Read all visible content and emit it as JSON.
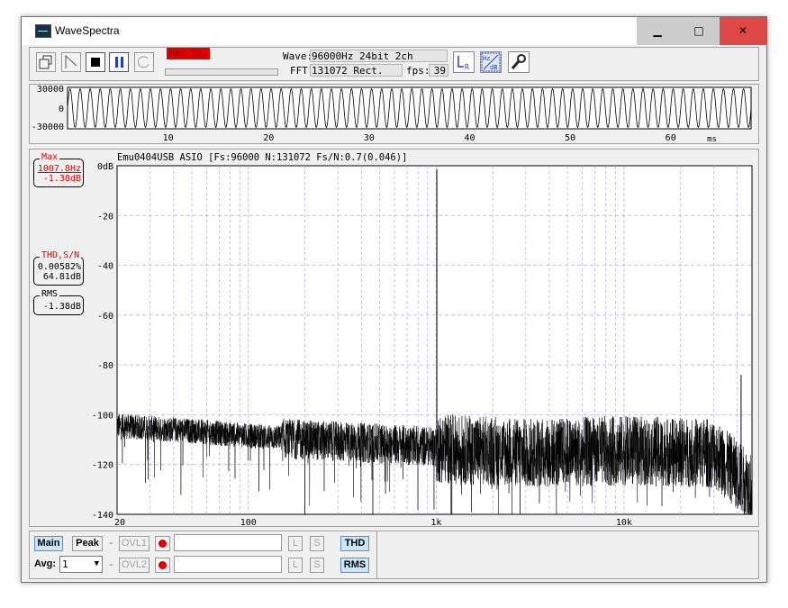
{
  "window": {
    "title": "WaveSpectra",
    "minimize_glyph": "▁",
    "maximize_glyph": "□",
    "close_glyph": "✕"
  },
  "toolbar": {
    "rec_badge": "Rec.In.",
    "wave_label": "Wave:",
    "wave_value": "96000Hz 24bit 2ch",
    "fft_label": "FFT:",
    "fft_value": "131072 Rect.",
    "fps_label": "fps:",
    "fps_value": "39",
    "lr_icon_text": "L R",
    "hzdb_icon_text": "Hz dB",
    "icons": [
      "open-icon",
      "ramp-icon",
      "stop-icon",
      "pause-icon",
      "refresh-icon",
      "lr-icon",
      "hz-db-icon",
      "settings-icon"
    ]
  },
  "waveform": {
    "y_ticks": [
      "30000",
      "0",
      "-30000"
    ],
    "x_ticks": [
      "10",
      "20",
      "30",
      "40",
      "50",
      "60"
    ],
    "x_unit": "ms",
    "x_range_ms": [
      0,
      68
    ],
    "frequency_hz": 1000,
    "amplitude": 28000
  },
  "spectrum": {
    "header": "Emu0404USB ASIO  [Fs:96000 N:131072 Fs/N:0.7(0.046)]",
    "max": {
      "label": "Max",
      "freq": "1007.8Hz",
      "level": "-1.38dB"
    },
    "thd": {
      "label": "THD,S/N",
      "thd": "0.00582%",
      "sn": "64.81dB"
    },
    "rms": {
      "label": "RMS",
      "value": "-1.38dB"
    }
  },
  "chart_data": {
    "type": "line",
    "xscale": "log",
    "xlim": [
      20,
      48000
    ],
    "ylim": [
      -140,
      0
    ],
    "x_tick_labels": [
      "20",
      "100",
      "1k",
      "10k"
    ],
    "y_tick_labels": [
      "0dB",
      "-20",
      "-40",
      "-60",
      "-80",
      "-100",
      "-120",
      "-140"
    ],
    "grid": true,
    "peaks": [
      {
        "x": 1007.8,
        "y": -1.38
      },
      {
        "x": 3000,
        "y": -128
      },
      {
        "x": 3300,
        "y": -116
      },
      {
        "x": 15000,
        "y": -116
      },
      {
        "x": 17000,
        "y": -123
      },
      {
        "x": 20000,
        "y": -108
      },
      {
        "x": 30000,
        "y": -119
      },
      {
        "x": 42000,
        "y": -84
      }
    ],
    "noise_floor": [
      {
        "x": 20,
        "y": -104
      },
      {
        "x": 50,
        "y": -106
      },
      {
        "x": 100,
        "y": -108
      },
      {
        "x": 300,
        "y": -110
      },
      {
        "x": 1000,
        "y": -112
      },
      {
        "x": 3000,
        "y": -114
      },
      {
        "x": 10000,
        "y": -113
      },
      {
        "x": 30000,
        "y": -114
      },
      {
        "x": 48000,
        "y": -128
      }
    ]
  },
  "bottom": {
    "main": "Main",
    "peak": "Peak",
    "avg_label": "Avg:",
    "avg_value": "1",
    "ovl1": "OVL1",
    "ovl2": "OVL2",
    "l": "L",
    "s": "S",
    "thd": "THD",
    "rms": "RMS",
    "dash": "-"
  }
}
